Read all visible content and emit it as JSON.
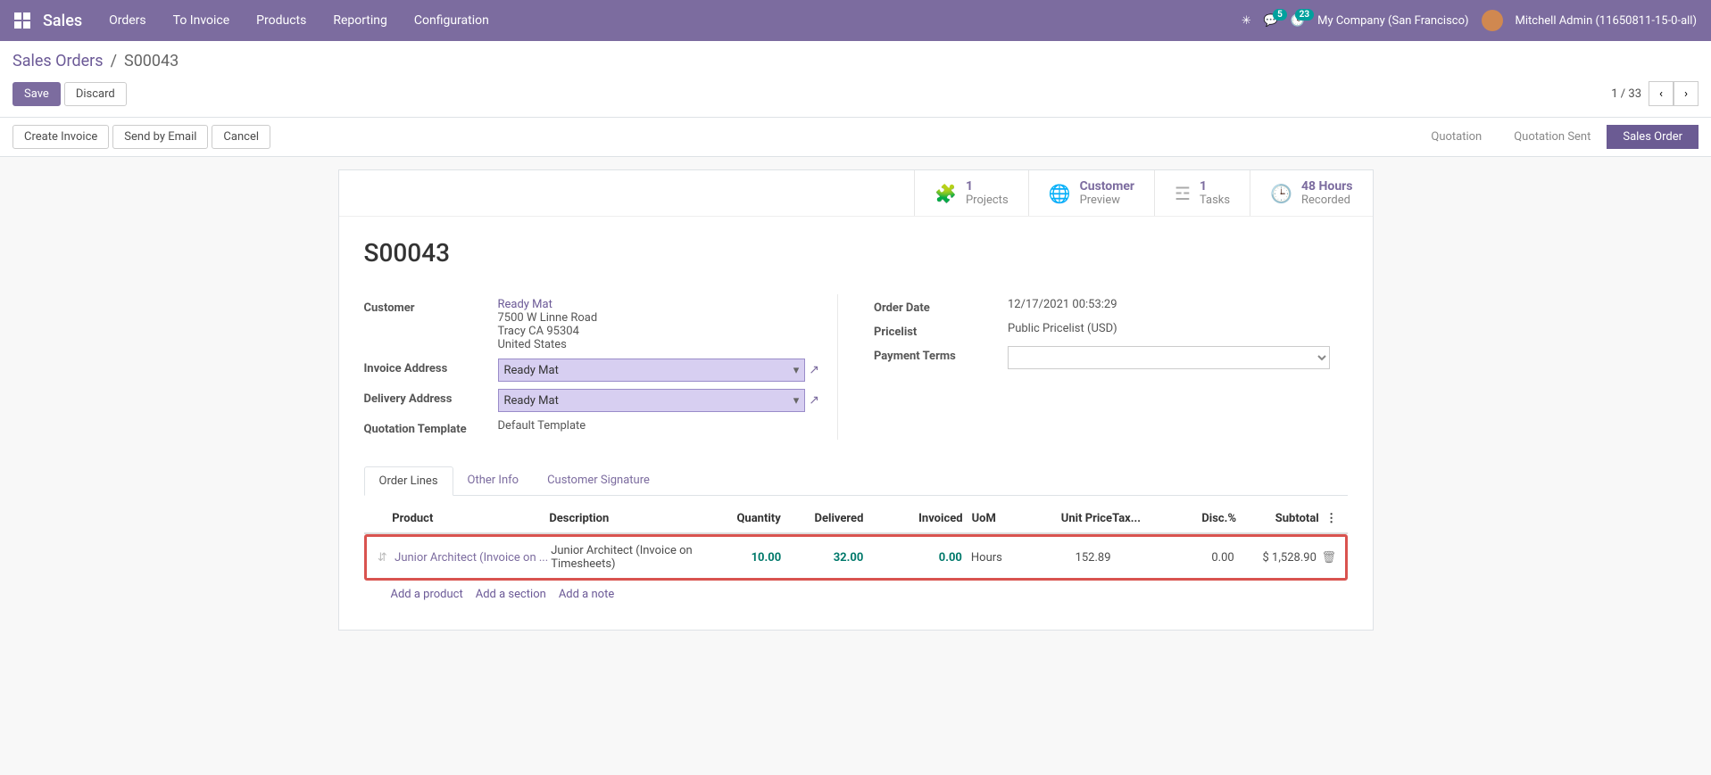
{
  "nav": {
    "brand": "Sales",
    "menu": [
      "Orders",
      "To Invoice",
      "Products",
      "Reporting",
      "Configuration"
    ],
    "msg_count": "5",
    "activity_count": "23",
    "company": "My Company (San Francisco)",
    "user": "Mitchell Admin (11650811-15-0-all)"
  },
  "breadcrumb": {
    "root": "Sales Orders",
    "current": "S00043"
  },
  "btns": {
    "save": "Save",
    "discard": "Discard",
    "create_invoice": "Create Invoice",
    "send_email": "Send by Email",
    "cancel": "Cancel"
  },
  "pager": {
    "text": "1 / 33"
  },
  "status": {
    "quotation": "Quotation",
    "quotation_sent": "Quotation Sent",
    "sales_order": "Sales Order"
  },
  "stats": {
    "projects": {
      "val": "1",
      "label": "Projects"
    },
    "preview": {
      "val": "Customer",
      "label": "Preview"
    },
    "tasks": {
      "val": "1",
      "label": "Tasks"
    },
    "recorded": {
      "val": "48 Hours",
      "label": "Recorded"
    }
  },
  "order": {
    "name": "S00043",
    "customer_name": "Ready Mat",
    "customer_addr1": "7500 W Linne Road",
    "customer_addr2": "Tracy CA 95304",
    "customer_country": "United States",
    "invoice_addr": "Ready Mat",
    "delivery_addr": "Ready Mat",
    "quote_template": "Default Template",
    "order_date": "12/17/2021 00:53:29",
    "pricelist": "Public Pricelist (USD)",
    "payment_terms": ""
  },
  "labels": {
    "customer": "Customer",
    "invoice_addr": "Invoice Address",
    "delivery_addr": "Delivery Address",
    "quote_template": "Quotation Template",
    "order_date": "Order Date",
    "pricelist": "Pricelist",
    "payment_terms": "Payment Terms"
  },
  "tabs": {
    "order_lines": "Order Lines",
    "other_info": "Other Info",
    "customer_sig": "Customer Signature"
  },
  "grid": {
    "head": {
      "product": "Product",
      "description": "Description",
      "quantity": "Quantity",
      "delivered": "Delivered",
      "invoiced": "Invoiced",
      "uom": "UoM",
      "unit_price": "Unit Price",
      "tax": "Tax...",
      "disc": "Disc.%",
      "subtotal": "Subtotal"
    },
    "row": {
      "product": "Junior Architect (Invoice on ...",
      "description": "Junior Architect (Invoice on Timesheets)",
      "qty": "10.00",
      "delivered": "32.00",
      "invoiced": "0.00",
      "uom": "Hours",
      "price": "152.89",
      "tax": "",
      "disc": "0.00",
      "subtotal": "$ 1,528.90"
    },
    "add": {
      "product": "Add a product",
      "section": "Add a section",
      "note": "Add a note"
    }
  }
}
